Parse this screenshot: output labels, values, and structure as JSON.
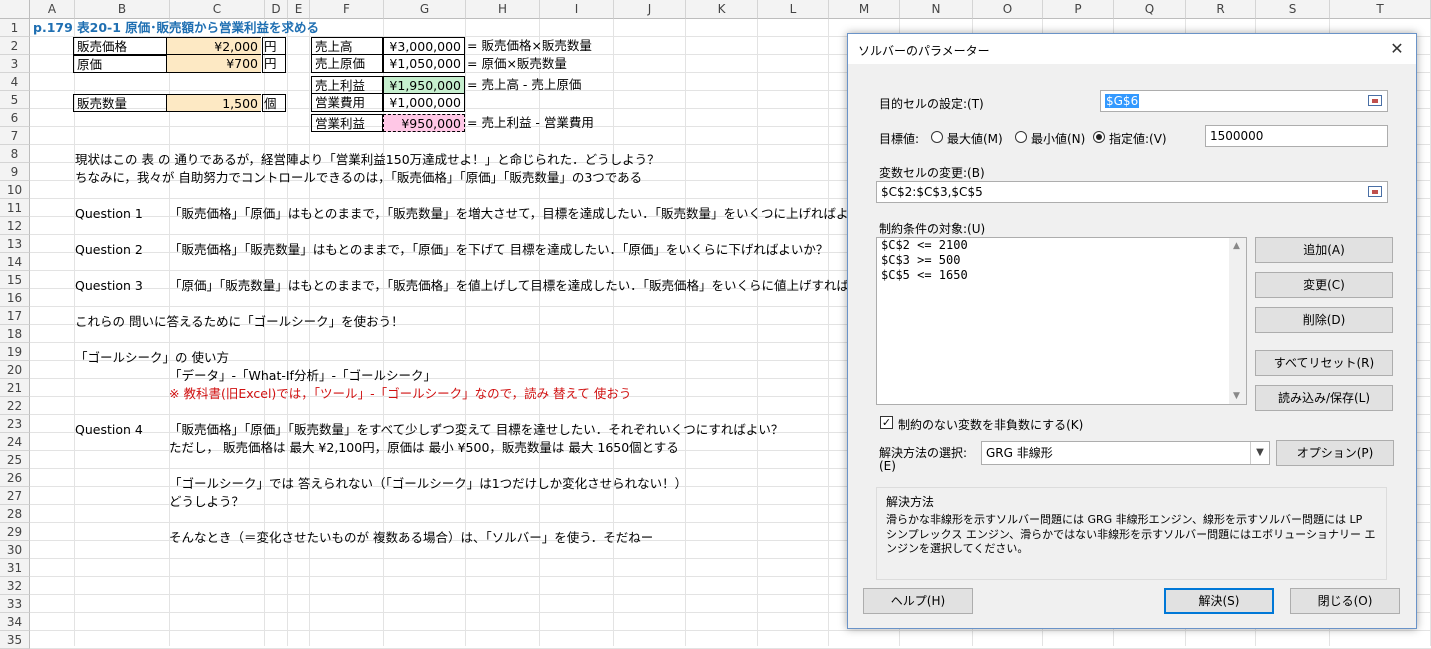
{
  "sheet": {
    "columns": [
      "A",
      "B",
      "C",
      "D",
      "E",
      "F",
      "G",
      "H",
      "I",
      "J",
      "K",
      "L",
      "M",
      "N",
      "O",
      "P",
      "Q",
      "R",
      "S",
      "T"
    ],
    "rows": [
      "1",
      "2",
      "3",
      "4",
      "5",
      "6",
      "7",
      "8",
      "9",
      "10",
      "11",
      "12",
      "13",
      "14",
      "15",
      "16",
      "17",
      "18",
      "19",
      "20",
      "21",
      "22",
      "23",
      "24",
      "25",
      "26",
      "27",
      "28",
      "29",
      "30",
      "31",
      "32",
      "33",
      "34",
      "35"
    ],
    "title": "p.179  表20-1  原価･販売額から営業利益を求める",
    "inputs": [
      {
        "label": "販売価格",
        "value": "¥2,000",
        "unit": "円"
      },
      {
        "label": "原価",
        "value": "¥700",
        "unit": "円"
      },
      {
        "label": "販売数量",
        "value": "1,500",
        "unit": "個"
      }
    ],
    "calc": [
      {
        "label": "売上高",
        "value": "¥3,000,000",
        "note": "= 販売価格×販売数量"
      },
      {
        "label": "売上原価",
        "value": "¥1,050,000",
        "note": "= 原価×販売数量"
      },
      {
        "label": "売上利益",
        "value": "¥1,950,000",
        "note": "= 売上高 - 売上原価"
      },
      {
        "label": "営業費用",
        "value": "¥1,000,000",
        "note": ""
      },
      {
        "label": "営業利益",
        "value": "¥950,000",
        "note": "= 売上利益 - 営業費用"
      }
    ],
    "text": {
      "r8": "現状はこの 表 の 通りであるが，経営陣より「営業利益150万達成せよ！」と命じられた．どうしよう？",
      "r9": "ちなみに，我々が 自助努力でコントロールできるのは，「販売価格」「原価」「販売数量」の3つである",
      "q1_label": "Question 1",
      "q1": "「販売価格」「原価」はもとのままで，「販売数量」を増大させて，目標を達成したい．「販売数量」をいくつに上げればよいか？",
      "q2_label": "Question 2",
      "q2": "「販売価格」「販売数量」はもとのままで，「原価」を下げて 目標を達成したい．「原価」をいくらに下げればよいか？",
      "q3_label": "Question 3",
      "q3": "「原価」「販売数量」はもとのままで，「販売価格」を値上げして目標を達成したい．「販売価格」をいくらに値上げすればよいか？",
      "r17": "これらの 問いに答えるために「ゴールシーク」を使おう！",
      "r19": "「ゴールシーク」の 使い方",
      "r20": "「データ」-「What-If分析」-「ゴールシーク」",
      "r21": "※ 教科書(旧Excel)では，「ツール」-「ゴールシーク」なので，読み 替えて 使おう",
      "q4_label": "Question 4",
      "q4": "「販売価格」「原価」「販売数量」をすべて少しずつ変えて 目標を達せしたい．それぞれいくつにすればよい？",
      "r24": "ただし，  販売価格は 最大 ¥2,100円，原価は 最小 ¥500，販売数量は 最大 1650個とする",
      "r26": "「ゴールシーク」では 答えられない（「ゴールシーク」は1つだけしか変化させられない！）",
      "r27": "どうしよう？",
      "r29": "そんなとき（＝変化させたいものが 複数ある場合）は、「ソルバー」を使う．そだねー"
    }
  },
  "dialog": {
    "title": "ソルバーのパラメーター",
    "close": "✕",
    "objective_label": "目的セルの設定:(T)",
    "objective_value": "$G$6",
    "target_label": "目標値:",
    "radio_max": "最大値(M)",
    "radio_min": "最小値(N)",
    "radio_value": "指定値:(V)",
    "target_value": "1500000",
    "changing_label": "変数セルの変更:(B)",
    "changing_value": "$C$2:$C$3,$C$5",
    "constraints_label": "制約条件の対象:(U)",
    "constraints": [
      "$C$2 <= 2100",
      "$C$3 >= 500",
      "$C$5 <= 1650"
    ],
    "buttons": {
      "add": "追加(A)",
      "change": "変更(C)",
      "delete": "削除(D)",
      "reset": "すべてリセット(R)",
      "load_save": "読み込み/保存(L)",
      "options": "オプション(P)",
      "help": "ヘルプ(H)",
      "solve": "解決(S)",
      "close": "閉じる(O)"
    },
    "nonneg_label": "制約のない変数を非負数にする(K)",
    "method_label_1": "解決方法の選択:",
    "method_label_2": "(E)",
    "method_value": "GRG 非線形",
    "desc_title": "解決方法",
    "desc_text": "滑らかな非線形を示すソルバー問題には GRG 非線形エンジン、線形を示すソルバー問題には LP シンプレックス エンジン、滑らかではない非線形を示すソルバー問題にはエボリューショナリー エンジンを選択してください。"
  }
}
